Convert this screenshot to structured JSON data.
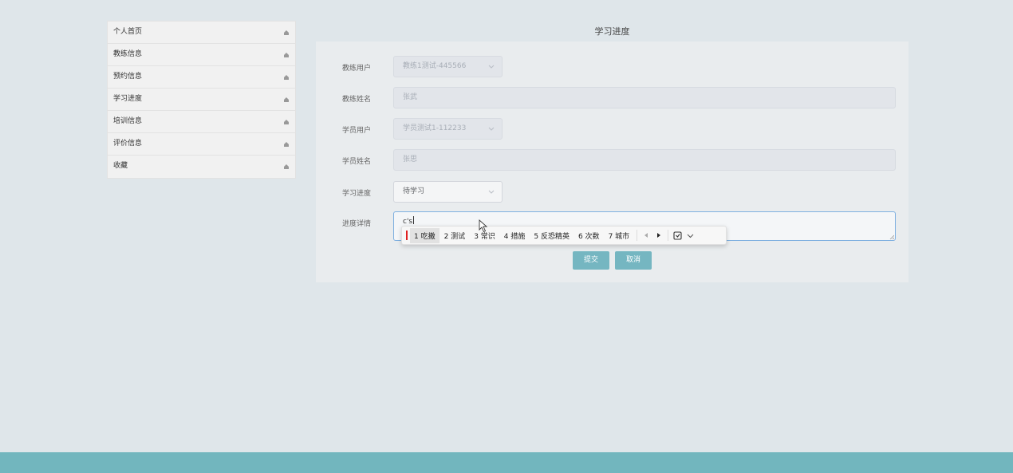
{
  "sidebar": {
    "items": [
      {
        "label": "个人首页"
      },
      {
        "label": "教练信息"
      },
      {
        "label": "预约信息"
      },
      {
        "label": "学习进度"
      },
      {
        "label": "培训信息"
      },
      {
        "label": "评价信息"
      },
      {
        "label": "收藏"
      }
    ],
    "icon": "home-icon"
  },
  "page": {
    "title": "学习进度"
  },
  "form": {
    "coach_user": {
      "label": "教练用户",
      "value": "教练1测试-445566"
    },
    "coach_name": {
      "label": "教练姓名",
      "value": "张武"
    },
    "student_user": {
      "label": "学员用户",
      "value": "学员测试1-112233"
    },
    "student_name": {
      "label": "学员姓名",
      "value": "张思"
    },
    "progress": {
      "label": "学习进度",
      "value": "待学习"
    },
    "progress_detail": {
      "label": "进度详情",
      "value": "c's"
    },
    "submit_label": "提交",
    "cancel_label": "取消"
  },
  "ime": {
    "candidates": [
      {
        "label": "1 吃撒"
      },
      {
        "label": "2 测试"
      },
      {
        "label": "3 常识"
      },
      {
        "label": "4 措施"
      },
      {
        "label": "5 反恐精英"
      },
      {
        "label": "6 次数"
      },
      {
        "label": "7 城市"
      }
    ]
  },
  "colors": {
    "accent": "#72b6be",
    "button": "#75b6c1",
    "ime_cursor": "#e02020"
  }
}
